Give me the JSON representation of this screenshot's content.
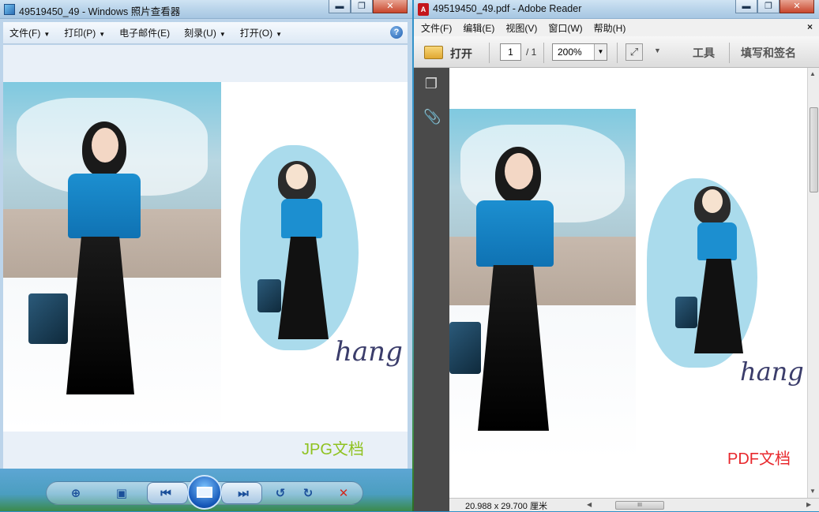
{
  "viewer": {
    "title": "49519450_49 - Windows 照片查看器",
    "menu": [
      "文件(F)",
      "打印(P)",
      "电子邮件(E)",
      "刻录(U)",
      "打开(O)"
    ],
    "help_glyph": "?",
    "caption": "JPG文档"
  },
  "reader": {
    "title": "49519450_49.pdf - Adobe Reader",
    "menu": [
      "文件(F)",
      "编辑(E)",
      "视图(V)",
      "窗口(W)",
      "帮助(H)"
    ],
    "close_glyph": "×",
    "open_label": "打开",
    "page_current": "1",
    "page_total": "/ 1",
    "zoom": "200%",
    "tools_label": "工具",
    "sign_label": "填写和签名",
    "page_dims": "20.988 x 29.700 厘米",
    "caption": "PDF文档",
    "drawing_text": "hang",
    "scroll_grip": "III"
  },
  "window_buttons": {
    "minimize": "▬",
    "maximize": "❐",
    "close": "✕"
  },
  "colors": {
    "jpg_caption": "#8fc220",
    "pdf_caption": "#e8282d",
    "sweater_blue": "#1c8fd0"
  }
}
